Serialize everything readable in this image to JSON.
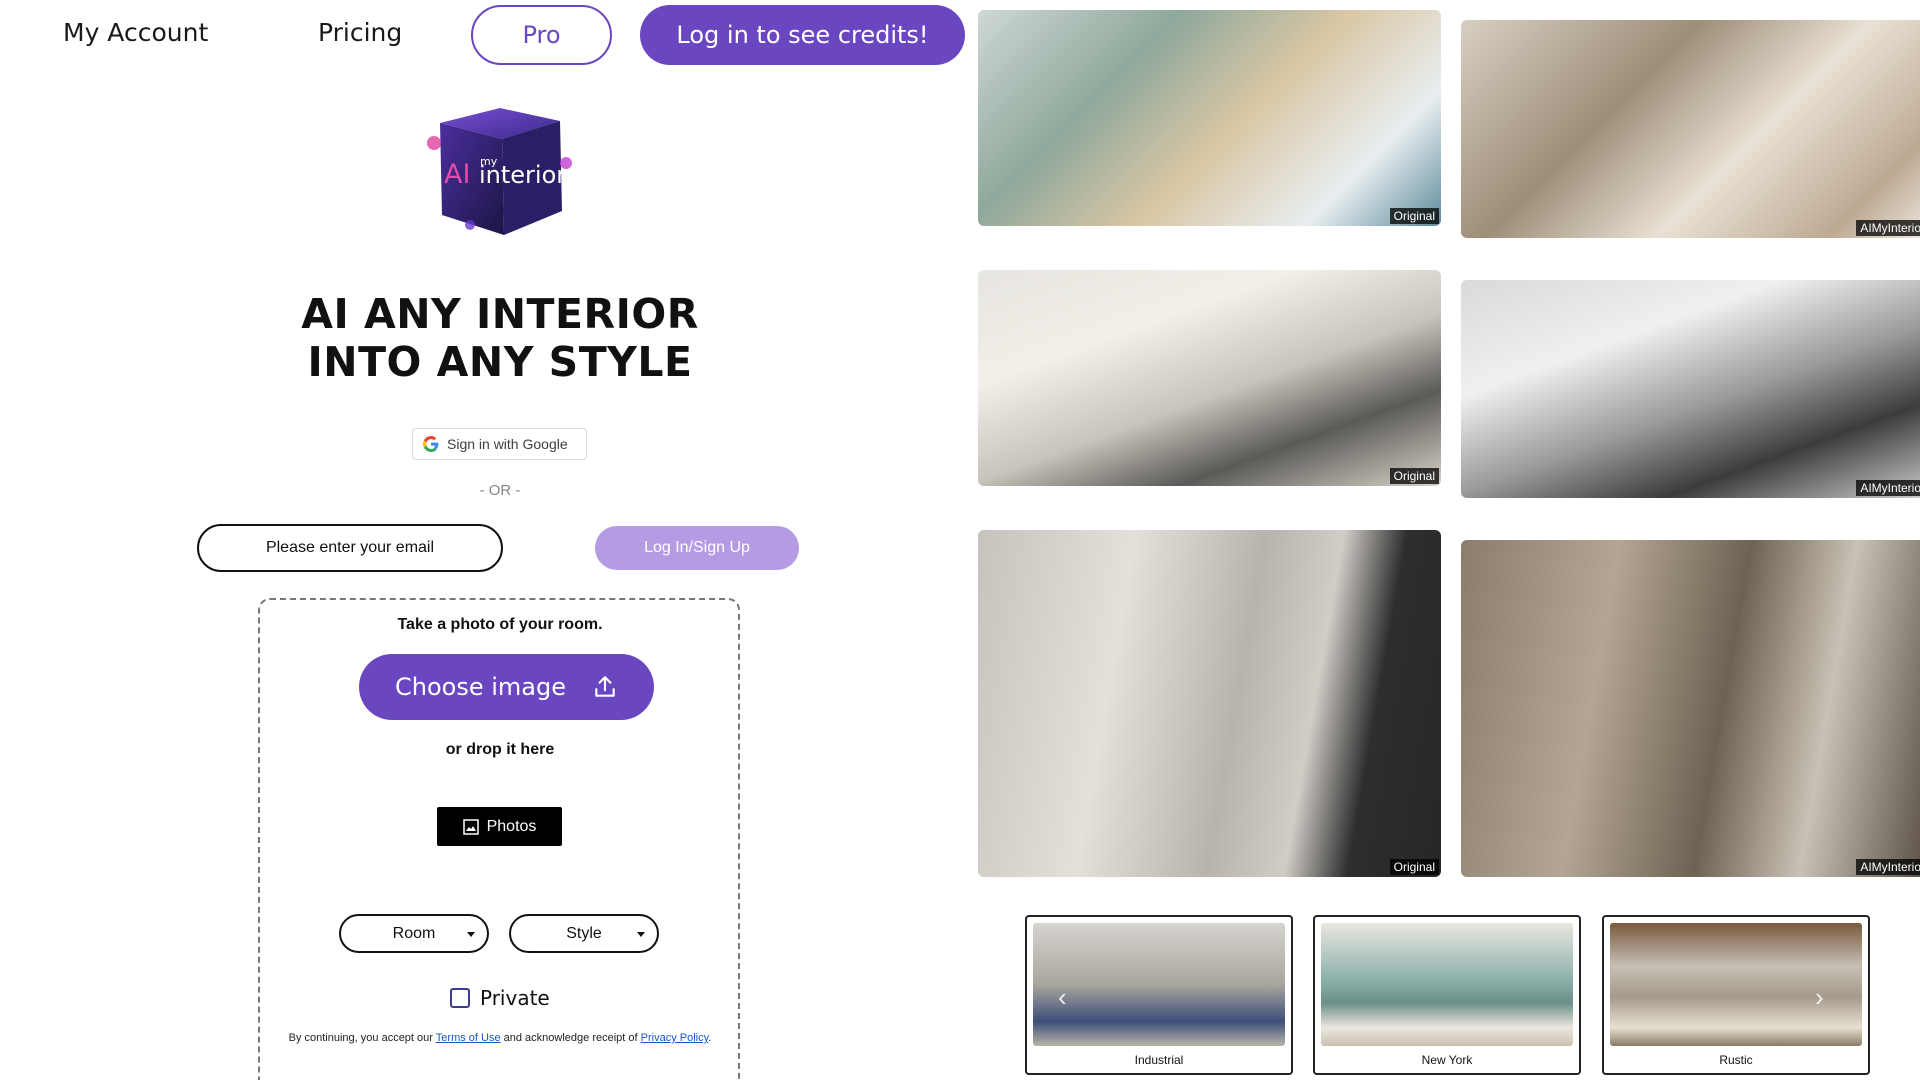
{
  "nav": {
    "account": "My Account",
    "pricing": "Pricing",
    "pro": "Pro",
    "credits": "Log in to see credits!"
  },
  "logo": {
    "ai": "AI",
    "my": "my",
    "interior": "interior"
  },
  "hero": {
    "line1": "AI ANY INTERIOR",
    "line2": "INTO ANY STYLE"
  },
  "auth": {
    "google_label": "Sign in with Google",
    "or": "- OR -",
    "email_placeholder": "Please enter your email",
    "login_label": "Log In/Sign Up"
  },
  "upload": {
    "prompt": "Take a photo of your room.",
    "choose_label": "Choose image",
    "drop_text": "or drop it here",
    "photos_label": "Photos",
    "room_label": "Room",
    "style_label": "Style",
    "private_label": "Private",
    "terms_prefix": "By continuing, you accept our ",
    "terms_link": "Terms of Use",
    "terms_middle": " and acknowledge receipt of ",
    "privacy_link": "Privacy Policy",
    "terms_suffix": "."
  },
  "gallery": {
    "original_tag": "Original",
    "result_tag": "AIMyInterior"
  },
  "styles": [
    {
      "label": "Industrial"
    },
    {
      "label": "New York"
    },
    {
      "label": "Rustic"
    }
  ],
  "colors": {
    "accent": "#6b46c1",
    "accent_light": "#b59be3",
    "link": "#1a57c7"
  }
}
